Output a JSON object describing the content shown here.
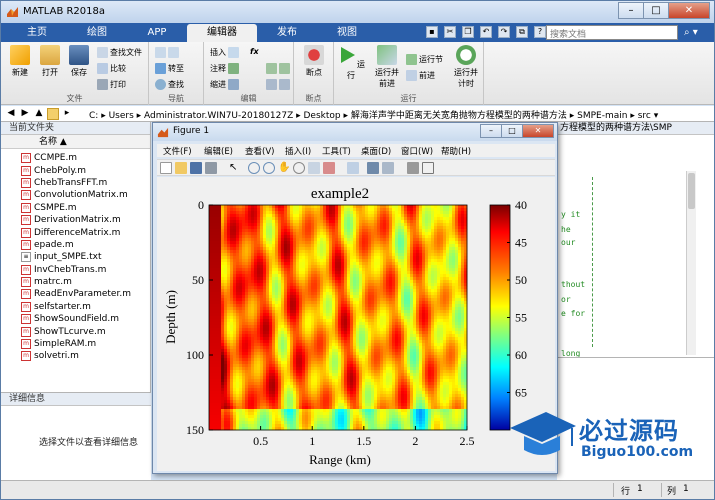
{
  "app": {
    "title": "MATLAB R2018a"
  },
  "tabs": [
    {
      "label": "主页",
      "selected": false
    },
    {
      "label": "绘图",
      "selected": false
    },
    {
      "label": "APP",
      "selected": false
    },
    {
      "label": "编辑器",
      "selected": true
    },
    {
      "label": "发布",
      "selected": false
    },
    {
      "label": "视图",
      "selected": false
    }
  ],
  "search": {
    "placeholder": "搜索文档"
  },
  "ribbon": {
    "file_group": {
      "label": "文件",
      "new": "新建",
      "open": "打开",
      "save": "保存",
      "find_files": "查找文件",
      "compare": "比较",
      "print": "打印"
    },
    "nav_group": {
      "label": "导航",
      "goto": "转至",
      "find": "查找"
    },
    "edit_group": {
      "label": "编辑",
      "insert": "插入",
      "comment": "注释",
      "indent": "缩进",
      "fx": "fx"
    },
    "breakpoint_group": {
      "label": "断点",
      "breakpoints": "断点"
    },
    "run_group": {
      "label": "运行",
      "run": "运行",
      "run_advance": "运行并\n前进",
      "run_section": "运行节",
      "advance": "前进",
      "run_time": "运行并\n计时"
    }
  },
  "address": {
    "segments": [
      "C:",
      "Users",
      "Administrator.WIN7U-20180127Z",
      "Desktop",
      "解海洋声学中距离无关宽角抛物方程模型的两种谱方法",
      "SMPE-main",
      "src"
    ]
  },
  "current_folder": {
    "title": "当前文件夹",
    "column": "名称",
    "files": [
      {
        "name": "CCMPE.m",
        "type": "m"
      },
      {
        "name": "ChebPoly.m",
        "type": "m"
      },
      {
        "name": "ChebTransFFT.m",
        "type": "m"
      },
      {
        "name": "ConvolutionMatrix.m",
        "type": "m"
      },
      {
        "name": "CSMPE.m",
        "type": "m"
      },
      {
        "name": "DerivationMatrix.m",
        "type": "m"
      },
      {
        "name": "DifferenceMatrix.m",
        "type": "m"
      },
      {
        "name": "epade.m",
        "type": "m"
      },
      {
        "name": "input_SMPE.txt",
        "type": "txt"
      },
      {
        "name": "InvChebTrans.m",
        "type": "m"
      },
      {
        "name": "matrc.m",
        "type": "m"
      },
      {
        "name": "ReadEnvParameter.m",
        "type": "m"
      },
      {
        "name": "selfstarter.m",
        "type": "m"
      },
      {
        "name": "ShowSoundField.m",
        "type": "m"
      },
      {
        "name": "ShowTLcurve.m",
        "type": "m"
      },
      {
        "name": "SimpleRAM.m",
        "type": "m"
      },
      {
        "name": "solvetri.m",
        "type": "m"
      }
    ]
  },
  "details": {
    "title": "详细信息",
    "message": "选择文件以查看详细信息"
  },
  "editor": {
    "title": "方程模型的两种谱方法\\SMP",
    "code_lines": [
      "y it",
      "he",
      "our",
      "",
      "",
      "thout",
      "or",
      "e for",
      "",
      "",
      "long"
    ]
  },
  "status": {
    "row_label": "行",
    "row_value": "1",
    "col_label": "列",
    "col_value": "1"
  },
  "figure": {
    "title": "Figure 1",
    "menu": [
      "文件(F)",
      "编辑(E)",
      "查看(V)",
      "插入(I)",
      "工具(T)",
      "桌面(D)",
      "窗口(W)",
      "帮助(H)"
    ]
  },
  "chart_data": {
    "type": "heatmap",
    "title": "example2",
    "xlabel": "Range (km)",
    "ylabel": "Depth (m)",
    "xlim": [
      0,
      2.5
    ],
    "ylim": [
      150,
      0
    ],
    "xticks": [
      "0.5",
      "1",
      "1.5",
      "2",
      "2.5"
    ],
    "yticks": [
      "0",
      "50",
      "100",
      "150"
    ],
    "colorbar": {
      "ticks": [
        "40",
        "45",
        "50",
        "55",
        "60",
        "65"
      ],
      "range": [
        40,
        70
      ],
      "reversed": true,
      "colors": [
        "#7a0000",
        "#ff0000",
        "#ff8000",
        "#ffff00",
        "#80ff80",
        "#00ffff",
        "#0080ff",
        "#0000a0"
      ]
    }
  },
  "watermark": {
    "brand": "必过源码",
    "url": "Biguo100.com"
  }
}
